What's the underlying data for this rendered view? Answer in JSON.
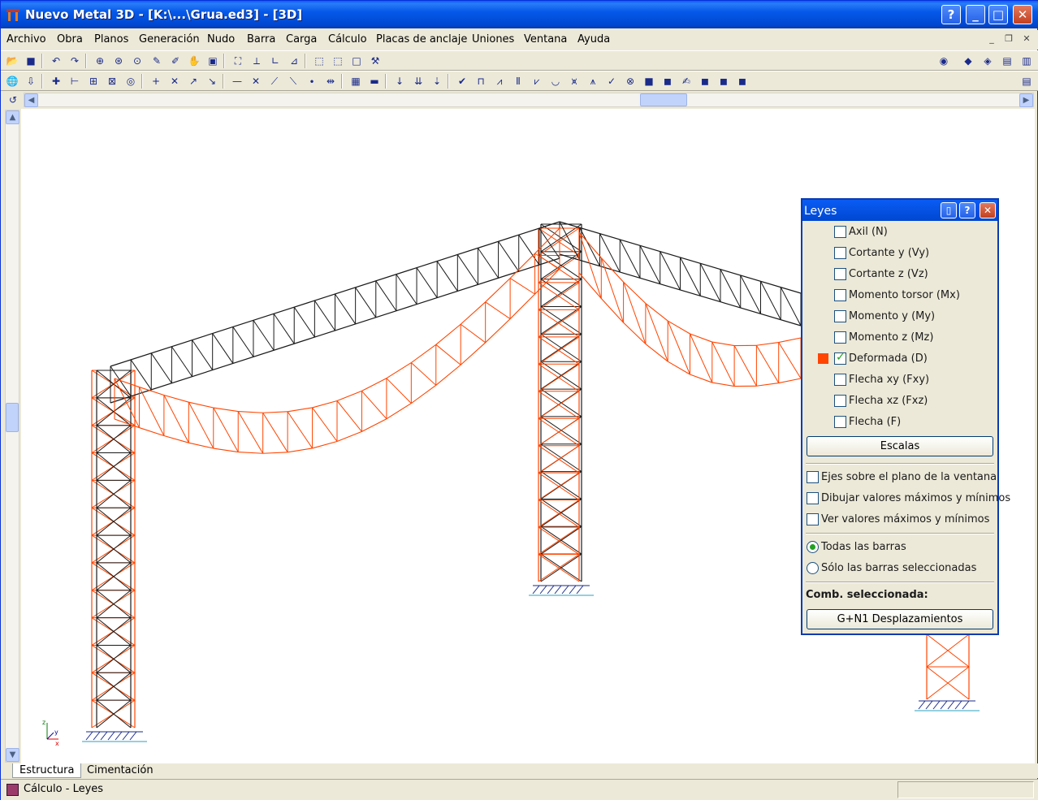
{
  "window": {
    "title": "Nuevo Metal 3D - [K:\\...\\Grua.ed3] - [3D]"
  },
  "menu": [
    "Archivo",
    "Obra",
    "Planos",
    "Generación",
    "Nudo",
    "Barra",
    "Carga",
    "Cálculo",
    "Placas de anclaje",
    "Uniones",
    "Ventana",
    "Ayuda"
  ],
  "tabs": {
    "structure": "Estructura",
    "foundation": "Cimentación"
  },
  "status": {
    "text": "Cálculo - Leyes"
  },
  "axes": {
    "z": "z",
    "y": "y",
    "x": "x"
  },
  "leyes": {
    "title": "Leyes",
    "checks": [
      {
        "label": "Axil (N)",
        "checked": false
      },
      {
        "label": "Cortante y (Vy)",
        "checked": false
      },
      {
        "label": "Cortante z (Vz)",
        "checked": false
      },
      {
        "label": "Momento torsor (Mx)",
        "checked": false
      },
      {
        "label": "Momento y (My)",
        "checked": false
      },
      {
        "label": "Momento z (Mz)",
        "checked": false
      },
      {
        "label": "Deformada (D)",
        "checked": true
      },
      {
        "label": "Flecha xy (Fxy)",
        "checked": false
      },
      {
        "label": "Flecha xz (Fxz)",
        "checked": false
      },
      {
        "label": "Flecha (F)",
        "checked": false
      }
    ],
    "scales_button": "Escalas",
    "options": [
      {
        "label": "Ejes sobre el plano de la ventana",
        "checked": false
      },
      {
        "label": "Dibujar valores máximos y mínimos",
        "checked": false
      },
      {
        "label": "Ver valores máximos y mínimos",
        "checked": false
      }
    ],
    "radios": [
      {
        "label": "Todas las barras",
        "checked": true
      },
      {
        "label": "Sólo las barras seleccionadas",
        "checked": false
      }
    ],
    "combo_label": "Comb. seleccionada:",
    "combo_button": "G+N1 Desplazamientos",
    "deformed_color": "#ff4500"
  }
}
